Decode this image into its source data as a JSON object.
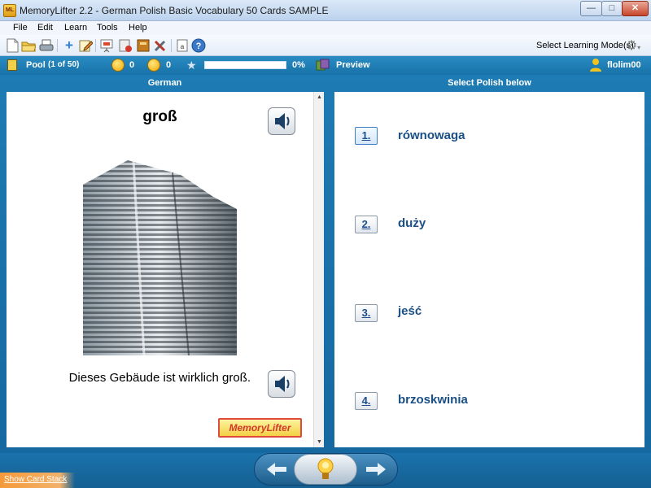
{
  "window": {
    "title": "MemoryLifter 2.2 - German Polish Basic Vocabulary 50 Cards SAMPLE",
    "app_icon": "ML",
    "minimize_icon": "minimize-icon",
    "maximize_icon": "maximize-icon",
    "close_icon": "close-icon"
  },
  "menu": [
    "File",
    "Edit",
    "Learn",
    "Tools",
    "Help"
  ],
  "toolbar": {
    "icons": [
      "new-file-icon",
      "open-folder-icon",
      "print-icon",
      "add-card-icon",
      "edit-card-icon",
      "slideshow-icon",
      "print-cards-icon",
      "dictionary-icon",
      "settings-tools-icon",
      "info-icon",
      "help-icon"
    ],
    "learning_mode_label": "Select Learning Mode(s)"
  },
  "status": {
    "pool_label": "Pool",
    "pool_count": "(1 of 50)",
    "correct_count": "0",
    "wrong_count": "0",
    "progress_percent_text": "0%",
    "progress_fraction": 0,
    "preview_label": "Preview",
    "username": "flolim00"
  },
  "question": {
    "header": "German",
    "word": "groß",
    "example": "Dieses Gebäude ist wirklich groß."
  },
  "answers": {
    "header": "Select Polish below",
    "options": [
      {
        "number": "1.",
        "text": "równowaga"
      },
      {
        "number": "2.",
        "text": "duży"
      },
      {
        "number": "3.",
        "text": "jeść"
      },
      {
        "number": "4.",
        "text": "brzoskwinia"
      }
    ]
  },
  "logo": {
    "text": "MemoryLifter"
  },
  "bottom": {
    "show_card_stack": "Show Card Stack",
    "back_icon": "arrow-left-icon",
    "hint_icon": "lightbulb-icon",
    "forward_icon": "arrow-right-icon"
  },
  "colors": {
    "accent": "#1b78b0",
    "answer_text": "#1a4f86",
    "progress": "#2db53a"
  }
}
